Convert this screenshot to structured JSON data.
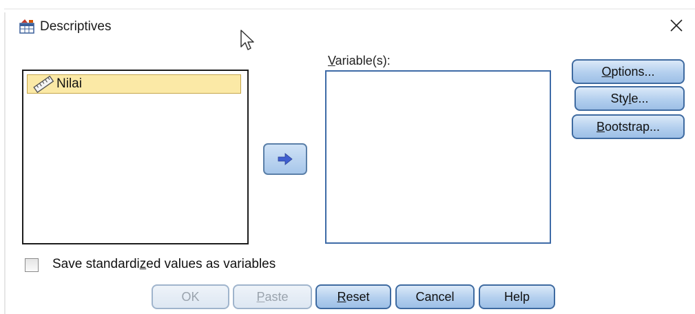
{
  "dialog": {
    "title": "Descriptives",
    "close_glyph": "✕",
    "icon": "descriptives-table-icon"
  },
  "source_list": {
    "items": [
      {
        "label": "Nilai",
        "icon": "ruler-icon",
        "selected": true
      }
    ]
  },
  "target_list": {
    "label_prefix": "V",
    "label_rest": "ariable(s):",
    "items": []
  },
  "move_button": {
    "icon": "right-arrow-icon"
  },
  "side_buttons": {
    "options_u": "O",
    "options_rest": "ptions...",
    "style_a": "Sty",
    "style_u": "l",
    "style_b": "e...",
    "bootstrap_u": "B",
    "bootstrap_rest": "ootstrap..."
  },
  "checkbox": {
    "label_a": "Save standardi",
    "label_u": "z",
    "label_b": "ed values as variables",
    "checked": false
  },
  "footer_buttons": {
    "ok": "OK",
    "paste_u": "P",
    "paste_rest": "aste",
    "reset_u": "R",
    "reset_rest": "eset",
    "cancel": "Cancel",
    "help": "Help"
  },
  "colors": {
    "selection": "#fbe9a6",
    "button_border": "#3e6aa0",
    "button_fill": "#b3cfee",
    "arrow": "#3f5fd0"
  }
}
